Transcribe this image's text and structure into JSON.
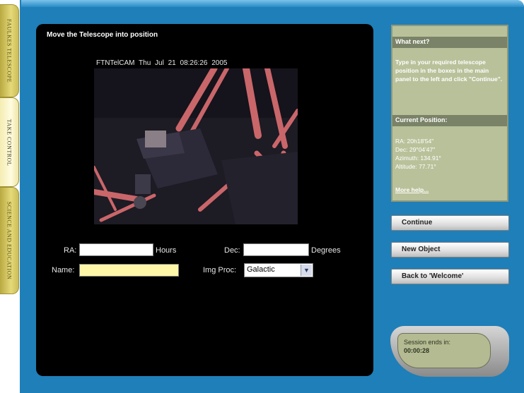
{
  "side_tabs": [
    {
      "label": "FAULKES TELESCOPE"
    },
    {
      "label": "TAKE CONTROL"
    },
    {
      "label": "SCIENCE AND EDUCATION"
    }
  ],
  "main": {
    "title": "Move the Telescope into position",
    "camera_caption": "FTNTelCAM  Thu Jul 21  08:26:26  2005"
  },
  "form": {
    "ra_label": "RA:",
    "ra_value": "",
    "ra_unit": "Hours",
    "dec_label": "Dec:",
    "dec_value": "",
    "dec_unit": "Degrees",
    "name_label": "Name:",
    "name_value": "",
    "img_proc_label": "Img Proc:",
    "img_proc_value": "Galactic"
  },
  "info_panel": {
    "what_next_header": "What next?",
    "what_next_text": "Type in your required telescope position in the boxes in the main panel to the left and click \"Continue\".",
    "position_header": "Current Position:",
    "ra": "RA: 20h18'54\"",
    "dec": "Dec: 29°04'47\"",
    "azimuth": "Azimuth: 134.91°",
    "altitude": "Altitude: 77.71°",
    "more_help": "More help..."
  },
  "buttons": {
    "continue": "Continue",
    "new_object": "New Object",
    "back": "Back to 'Welcome'"
  },
  "session": {
    "label": "Session ends in:",
    "time": "00:00:28"
  },
  "colors": {
    "frame": "#1f7fb8",
    "panel": "#000000",
    "info_bg": "#b9c19a",
    "tab_gold": "#d9cc6a",
    "name_field": "#fff7a8"
  }
}
